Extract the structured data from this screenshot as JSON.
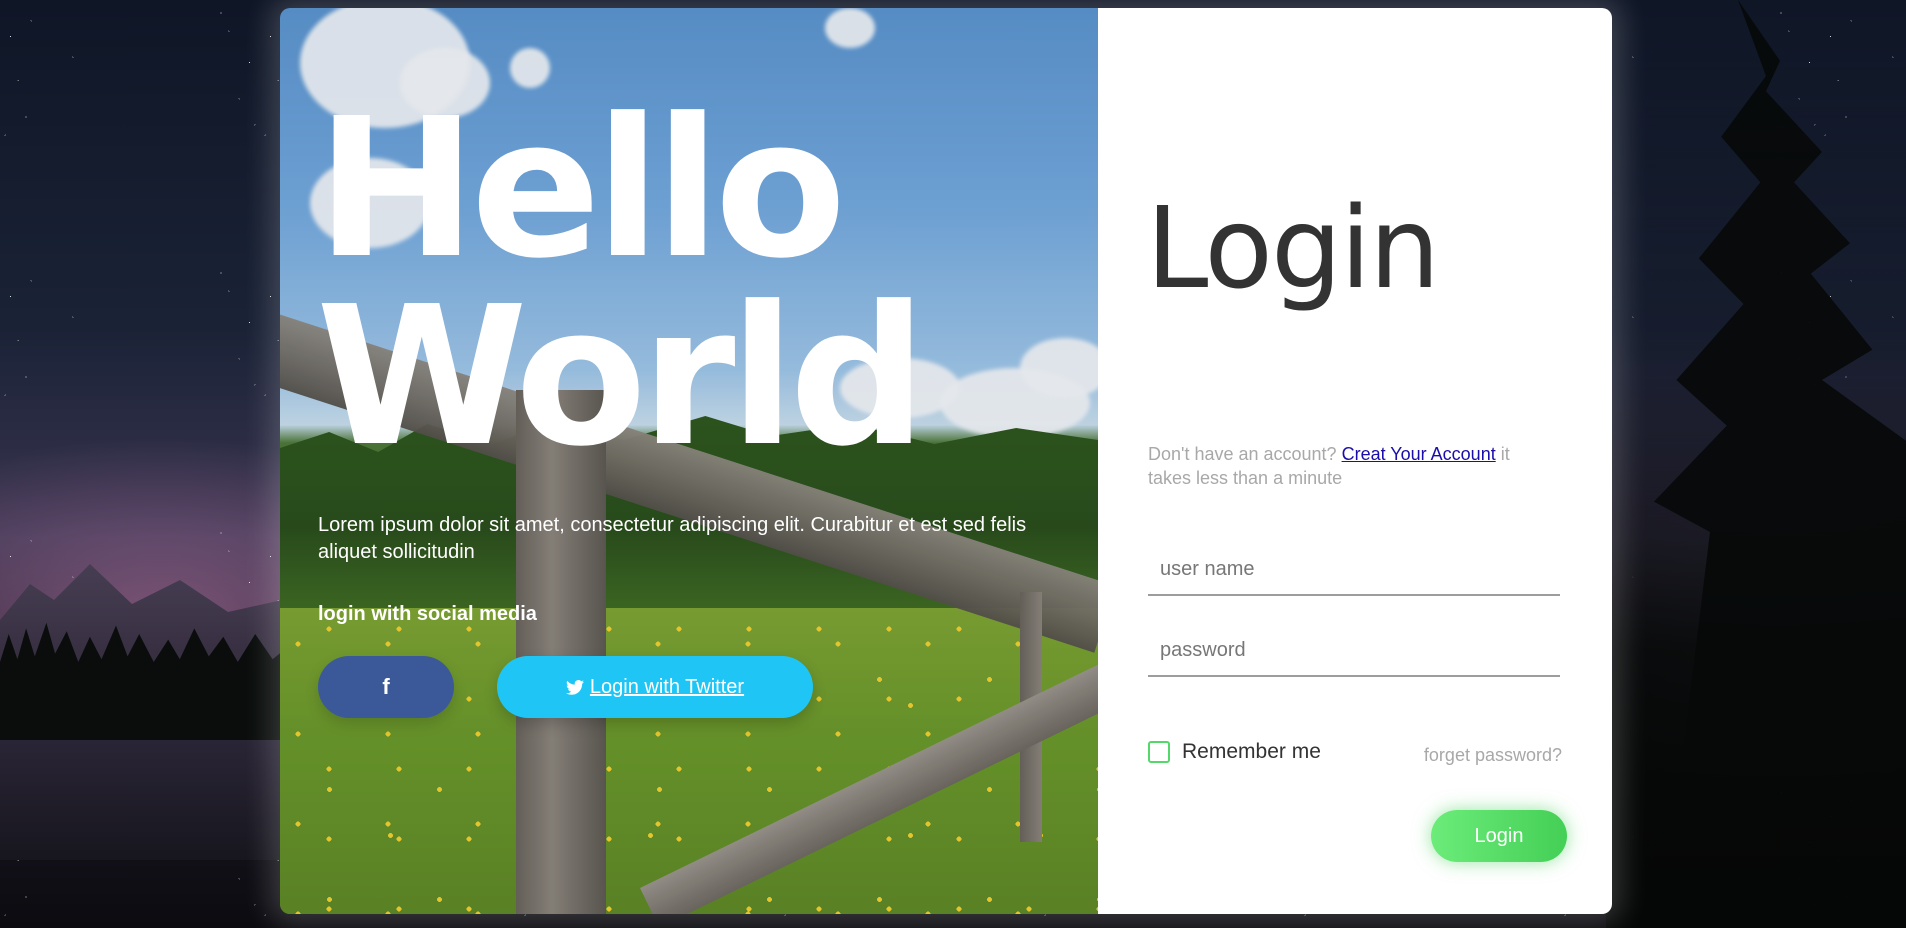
{
  "hero": {
    "line1": "Hello",
    "line2": "World",
    "description": "Lorem ipsum dolor sit amet, consectetur adipiscing elit. Curabitur et est sed felis aliquet sollicitudin",
    "social_label": "login with social media",
    "facebook_icon": "f",
    "twitter_label": "Login with Twitter"
  },
  "login": {
    "title": "Login",
    "account_prefix": "Don't have an account?",
    "account_link": "Creat Your Account",
    "account_suffix": "it takes less than a minute",
    "username_placeholder": "user name",
    "password_placeholder": "password",
    "remember_label": "Remember me",
    "forgot_label": "forget password?",
    "submit_label": "Login"
  },
  "colors": {
    "facebook": "#3b5998",
    "twitter": "#1fc6f5",
    "login_button": "#44cf56",
    "checkbox_border": "#55d86a"
  }
}
